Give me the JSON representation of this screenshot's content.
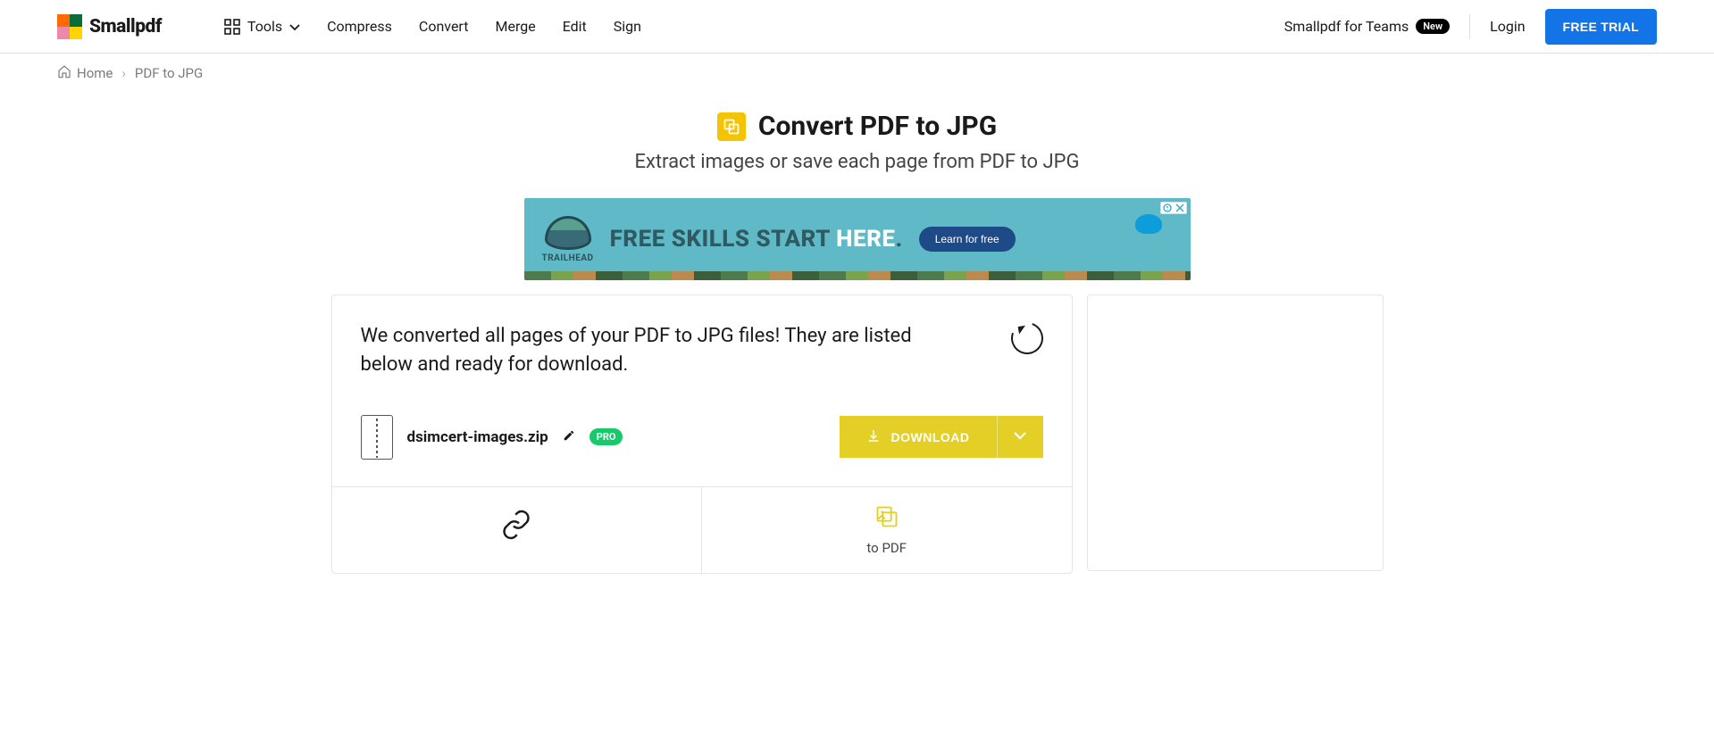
{
  "header": {
    "brand": "Smallpdf",
    "tools": "Tools",
    "nav": [
      {
        "label": "Compress"
      },
      {
        "label": "Convert"
      },
      {
        "label": "Merge"
      },
      {
        "label": "Edit"
      },
      {
        "label": "Sign"
      }
    ],
    "teams": "Smallpdf for Teams",
    "new_badge": "New",
    "login": "Login",
    "free_trial": "FREE TRIAL"
  },
  "breadcrumb": {
    "home": "Home",
    "current": "PDF to JPG"
  },
  "hero": {
    "title": "Convert PDF to JPG",
    "subtitle": "Extract images or save each page from PDF to JPG",
    "icon": "convert-pdf-to-jpg"
  },
  "ad": {
    "brand": "TRAILHEAD",
    "headline_a": "FREE SKILLS START ",
    "headline_b": "HERE",
    "headline_c": ".",
    "cta": "Learn for free"
  },
  "main": {
    "converted_message": "We converted all pages of your PDF to JPG files! They are listed below and ready for download.",
    "filename": "dsimcert-images.zip",
    "pro_badge": "PRO",
    "download_label": "DOWNLOAD"
  },
  "actions": {
    "link_label": "",
    "to_pdf_label": "to PDF"
  }
}
